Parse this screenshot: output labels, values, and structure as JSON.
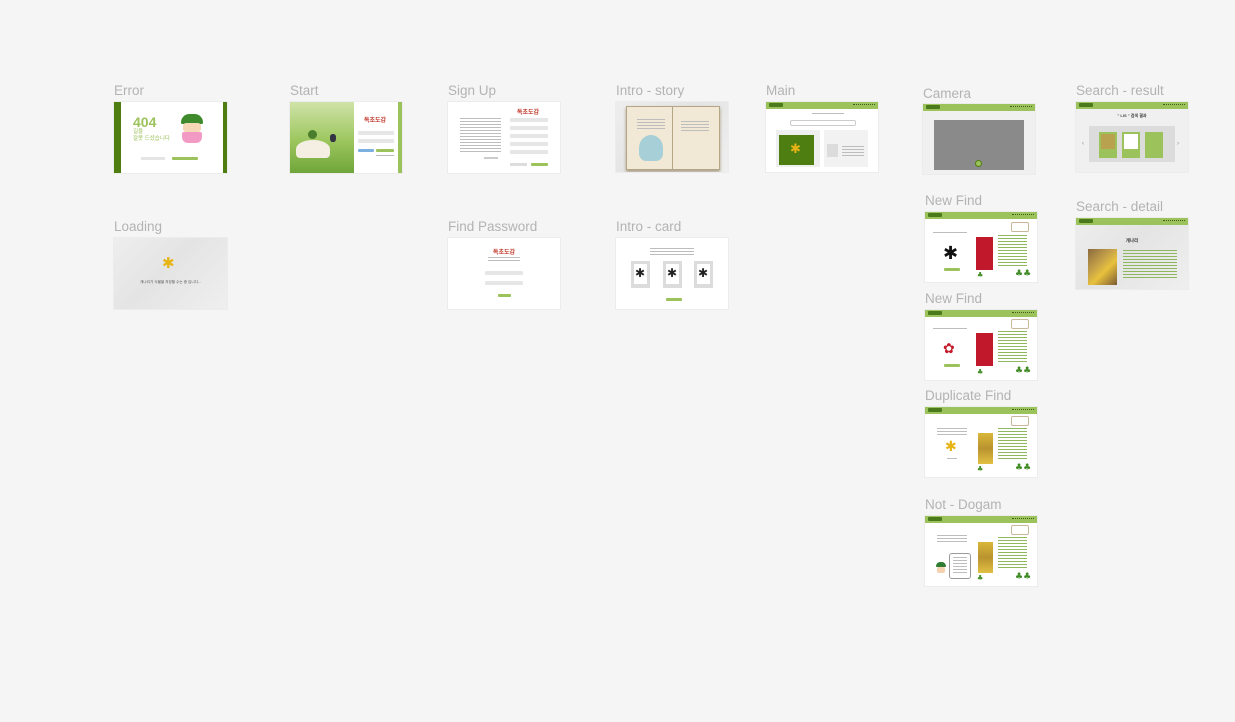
{
  "frames": {
    "error": "Error",
    "start": "Start",
    "signup": "Sign Up",
    "intro_story": "Intro - story",
    "main": "Main",
    "camera": "Camera",
    "search_result": "Search - result",
    "loading": "Loading",
    "find_password": "Find Password",
    "intro_card": "Intro - card",
    "new_find_1": "New Find",
    "search_detail": "Search - detail",
    "new_find_2": "New Find",
    "duplicate_find": "Duplicate Find",
    "not_dogam": "Not - Dogam"
  },
  "content": {
    "error_code": "404",
    "error_msg": "길을\n잘못 드셨습니다",
    "app_title": "독초도감",
    "loading_msg": "개나리가 식물을 저장할 수는 중 입니다...",
    "search_result_title": "\" LIS \" 검색 결과",
    "search_detail_title": "개나리"
  },
  "colors": {
    "canvas": "#f5f5f5",
    "label": "#b3b3b3",
    "brand_green": "#9cc25b",
    "dark_green": "#4e7e12",
    "title_red": "#c0392b"
  }
}
